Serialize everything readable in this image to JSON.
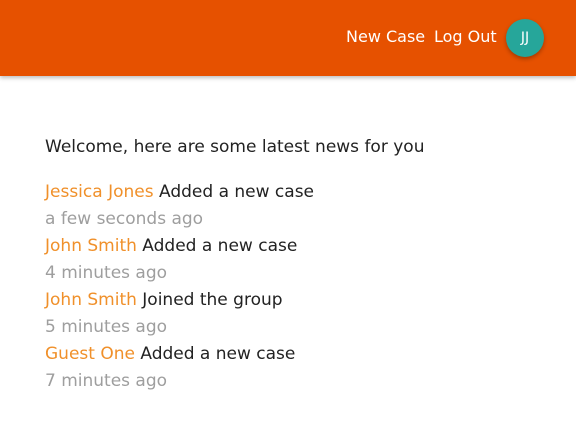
{
  "header": {
    "new_case_label": "New Case",
    "logout_label": "Log Out",
    "avatar_initials": "JJ",
    "bar_color": "#e65100",
    "avatar_color": "#26a69a"
  },
  "main": {
    "welcome_text": "Welcome, here are some latest news for you",
    "news": [
      {
        "user": "Jessica Jones",
        "action": "Added a new case",
        "time": "a few seconds ago"
      },
      {
        "user": "John Smith",
        "action": "Added a new case",
        "time": "4 minutes ago"
      },
      {
        "user": "John Smith",
        "action": "Joined the group",
        "time": "5 minutes ago"
      },
      {
        "user": "Guest One",
        "action": "Added a new case",
        "time": "7 minutes ago"
      }
    ]
  }
}
